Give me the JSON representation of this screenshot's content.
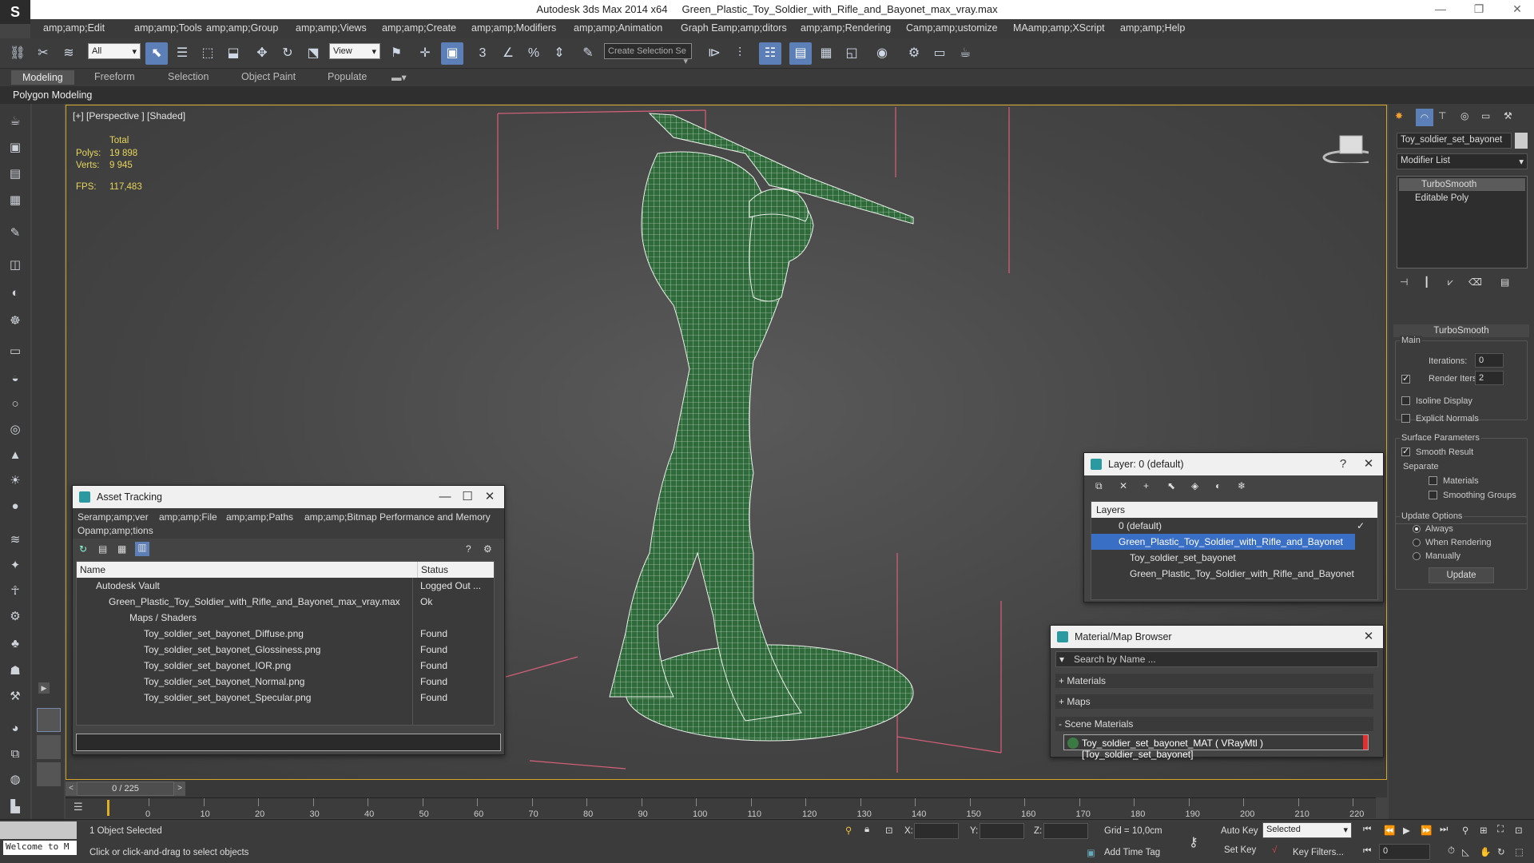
{
  "window": {
    "app_title": "Autodesk 3ds Max  2014 x64",
    "file_title": "Green_Plastic_Toy_Soldier_with_Rifle_and_Bayonet_max_vray.max"
  },
  "menu": [
    "amp;amp;Edit",
    "amp;amp;Tools",
    "amp;amp;Group",
    "amp;amp;Views",
    "amp;amp;Create",
    "amp;amp;Modifiers",
    "amp;amp;Animation",
    "Graph Eamp;amp;ditors",
    "amp;amp;Rendering",
    "Camp;amp;ustomize",
    "MAamp;amp;XScript",
    "amp;amp;Help"
  ],
  "toolbar": {
    "filter_value": "All",
    "refcoord_value": "View",
    "selection_set_placeholder": "Create Selection Se"
  },
  "ribbon": {
    "tabs": [
      "Modeling",
      "Freeform",
      "Selection",
      "Object Paint",
      "Populate"
    ],
    "sub_label": "Polygon Modeling"
  },
  "viewport": {
    "label": "[+] [Perspective ] [Shaded]",
    "stats_header": "Total",
    "polys_label": "Polys:",
    "polys_value": "19 898",
    "verts_label": "Verts:",
    "verts_value": "9 945",
    "fps_label": "FPS:",
    "fps_value": "117,483"
  },
  "asset_tracking": {
    "title": "Asset Tracking",
    "menu": [
      "Seramp;amp;ver",
      "amp;amp;File",
      "amp;amp;Paths",
      "amp;amp;Bitmap Performance and Memory"
    ],
    "menu2": "Opamp;amp;tions",
    "col_name": "Name",
    "col_status": "Status",
    "rows": [
      {
        "name": "Autodesk Vault",
        "status": "Logged Out ..."
      },
      {
        "name": "Green_Plastic_Toy_Soldier_with_Rifle_and_Bayonet_max_vray.max",
        "status": "Ok"
      },
      {
        "name": "Maps / Shaders",
        "status": ""
      },
      {
        "name": "Toy_soldier_set_bayonet_Diffuse.png",
        "status": "Found"
      },
      {
        "name": "Toy_soldier_set_bayonet_Glossiness.png",
        "status": "Found"
      },
      {
        "name": "Toy_soldier_set_bayonet_IOR.png",
        "status": "Found"
      },
      {
        "name": "Toy_soldier_set_bayonet_Normal.png",
        "status": "Found"
      },
      {
        "name": "Toy_soldier_set_bayonet_Specular.png",
        "status": "Found"
      }
    ]
  },
  "layer_dialog": {
    "title": "Layer: 0 (default)",
    "help": "?",
    "header": "Layers",
    "rows": [
      "0 (default)",
      "Green_Plastic_Toy_Soldier_with_Rifle_and_Bayonet",
      "Toy_soldier_set_bayonet",
      "Green_Plastic_Toy_Soldier_with_Rifle_and_Bayonet"
    ]
  },
  "material_browser": {
    "title": "Material/Map Browser",
    "search_placeholder": "Search by Name ...",
    "sections": [
      "+ Materials",
      "+ Maps",
      "- Scene Materials"
    ],
    "scene_material": "Toy_soldier_set_bayonet_MAT ( VRayMtl ) [Toy_soldier_set_bayonet]"
  },
  "command_panel": {
    "object_name": "Toy_soldier_set_bayonet",
    "modifier_list": "Modifier List",
    "stack": [
      "TurboSmooth",
      "Editable Poly"
    ],
    "rollout": "TurboSmooth",
    "main_label": "Main",
    "iterations_label": "Iterations:",
    "iterations_value": "0",
    "render_iters_label": "Render Iters:",
    "render_iters_value": "2",
    "isoline": "Isoline Display",
    "explicit_normals": "Explicit Normals",
    "surface_params": "Surface Parameters",
    "smooth_result": "Smooth Result",
    "separate": "Separate",
    "materials": "Materials",
    "smoothing_groups": "Smoothing Groups",
    "update_options": "Update Options",
    "always": "Always",
    "when_rendering": "When Rendering",
    "manually": "Manually",
    "update_btn": "Update"
  },
  "timeline": {
    "frame": "0 / 225",
    "ticks": [
      "0",
      "10",
      "20",
      "30",
      "40",
      "50",
      "60",
      "70",
      "80",
      "90",
      "100",
      "110",
      "120",
      "130",
      "140",
      "150",
      "160",
      "170",
      "180",
      "190",
      "200",
      "210",
      "220"
    ]
  },
  "status": {
    "maxscript": "Welcome to M",
    "selected": "1 Object Selected",
    "prompt": "Click or click-and-drag to select objects",
    "x_label": "X:",
    "y_label": "Y:",
    "z_label": "Z:",
    "grid": "Grid = 10,0cm",
    "add_time_tag": "Add Time Tag",
    "auto_key": "Auto Key",
    "set_key": "Set Key",
    "selected_value": "Selected",
    "key_filters": "Key Filters...",
    "frame_value": "0"
  }
}
